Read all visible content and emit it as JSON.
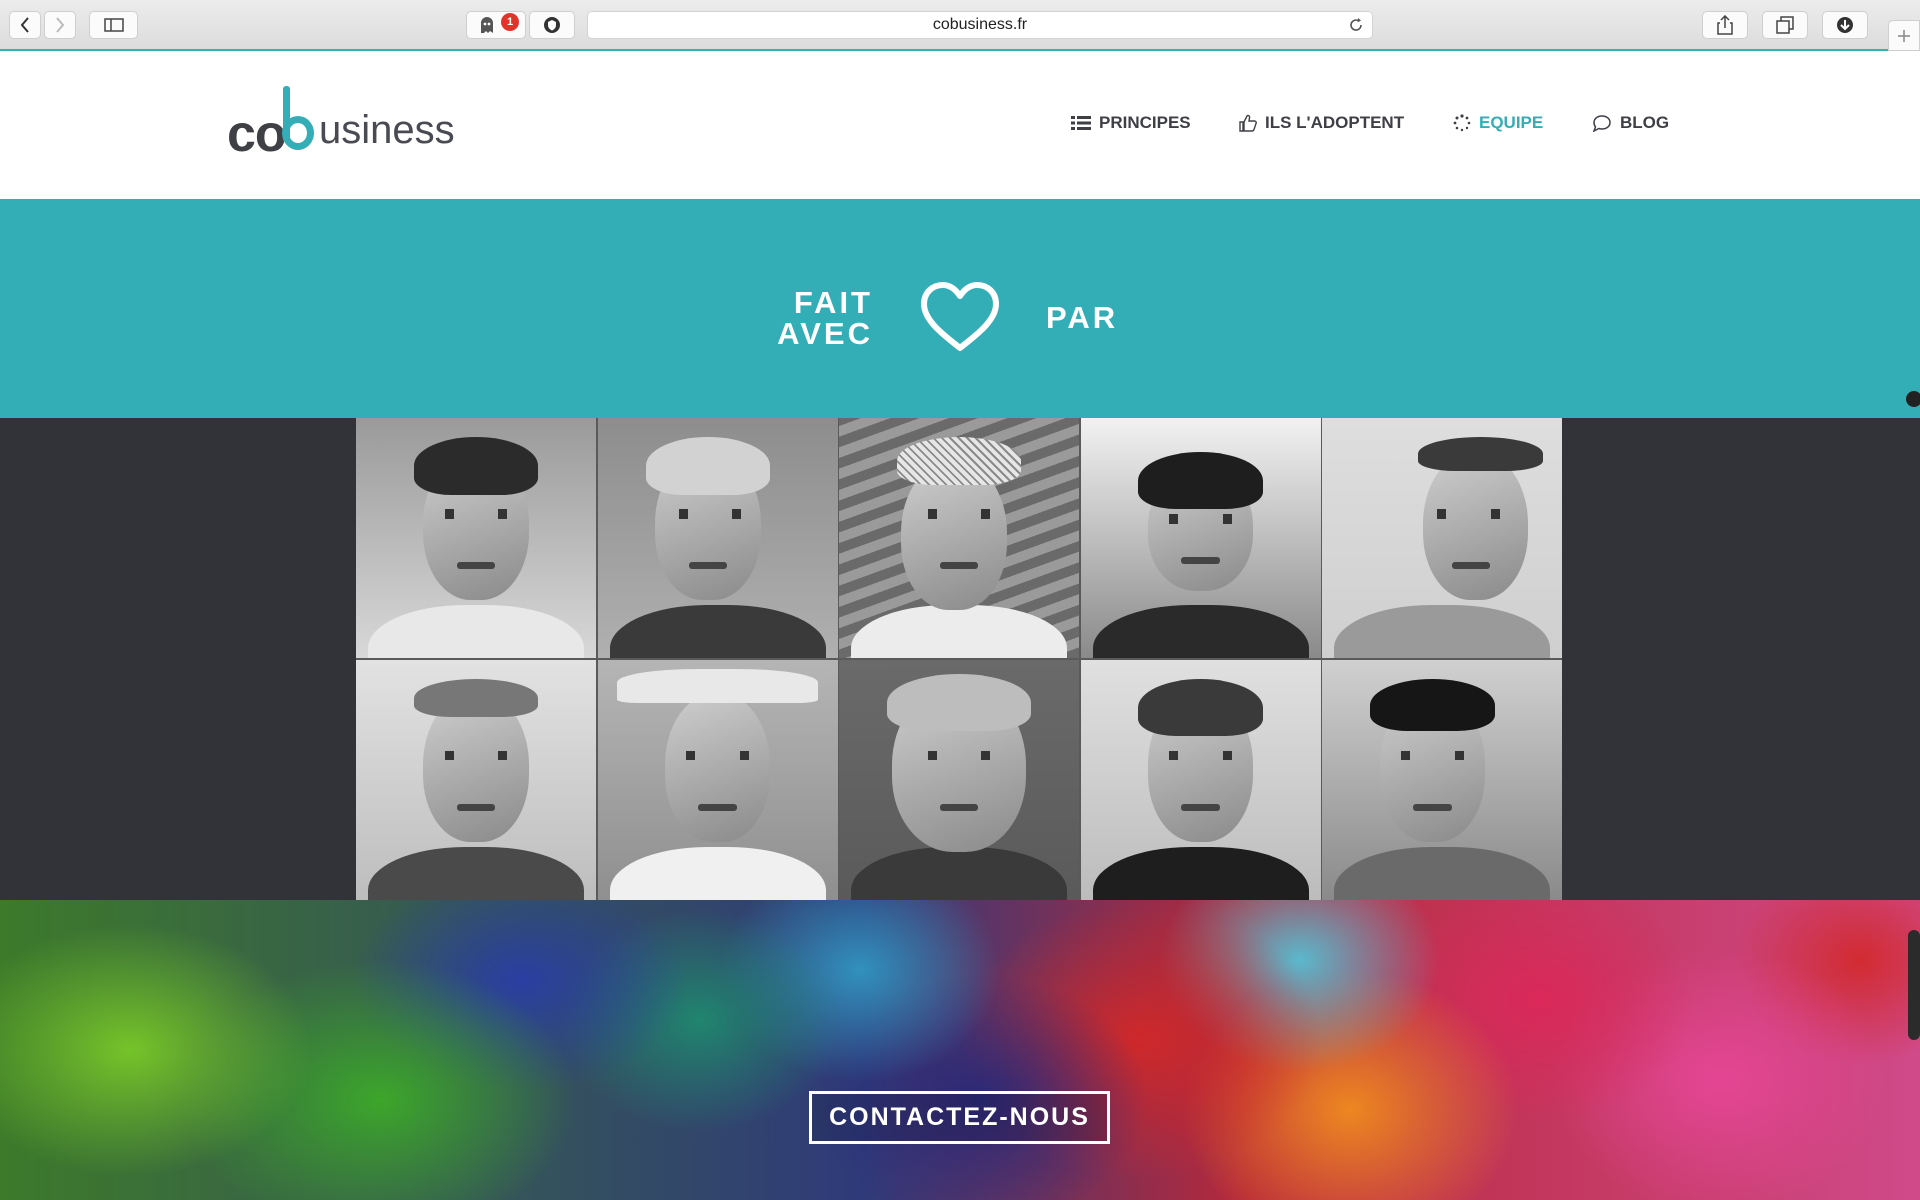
{
  "browser": {
    "url": "cobusiness.fr",
    "extension_badge": "1",
    "icons": [
      "back-icon",
      "forward-icon",
      "sidebar-icon",
      "ghost-icon",
      "shield-icon",
      "reload-icon",
      "share-icon",
      "tabs-icon",
      "download-icon",
      "new-tab-icon"
    ]
  },
  "site": {
    "logo": {
      "co": "co",
      "rest": "usiness"
    },
    "nav": [
      {
        "label": "PRINCIPES",
        "icon": "list-icon"
      },
      {
        "label": "ILS L'ADOPTENT",
        "icon": "thumbs-up-icon"
      },
      {
        "label": "EQUIPE",
        "icon": "spinner-icon",
        "active": true
      },
      {
        "label": "BLOG",
        "icon": "chat-bubble-icon"
      }
    ]
  },
  "hero": {
    "line1": "FAIT",
    "line2": "AVEC",
    "line3": "PAR",
    "icon": "heart-icon"
  },
  "team": {
    "photo_count": 10
  },
  "footer": {
    "contact_label": "CONTACTEZ-NOUS"
  },
  "colors": {
    "accent": "#33aeb6",
    "dark_band": "#323338",
    "text_dark": "#3f4046"
  }
}
